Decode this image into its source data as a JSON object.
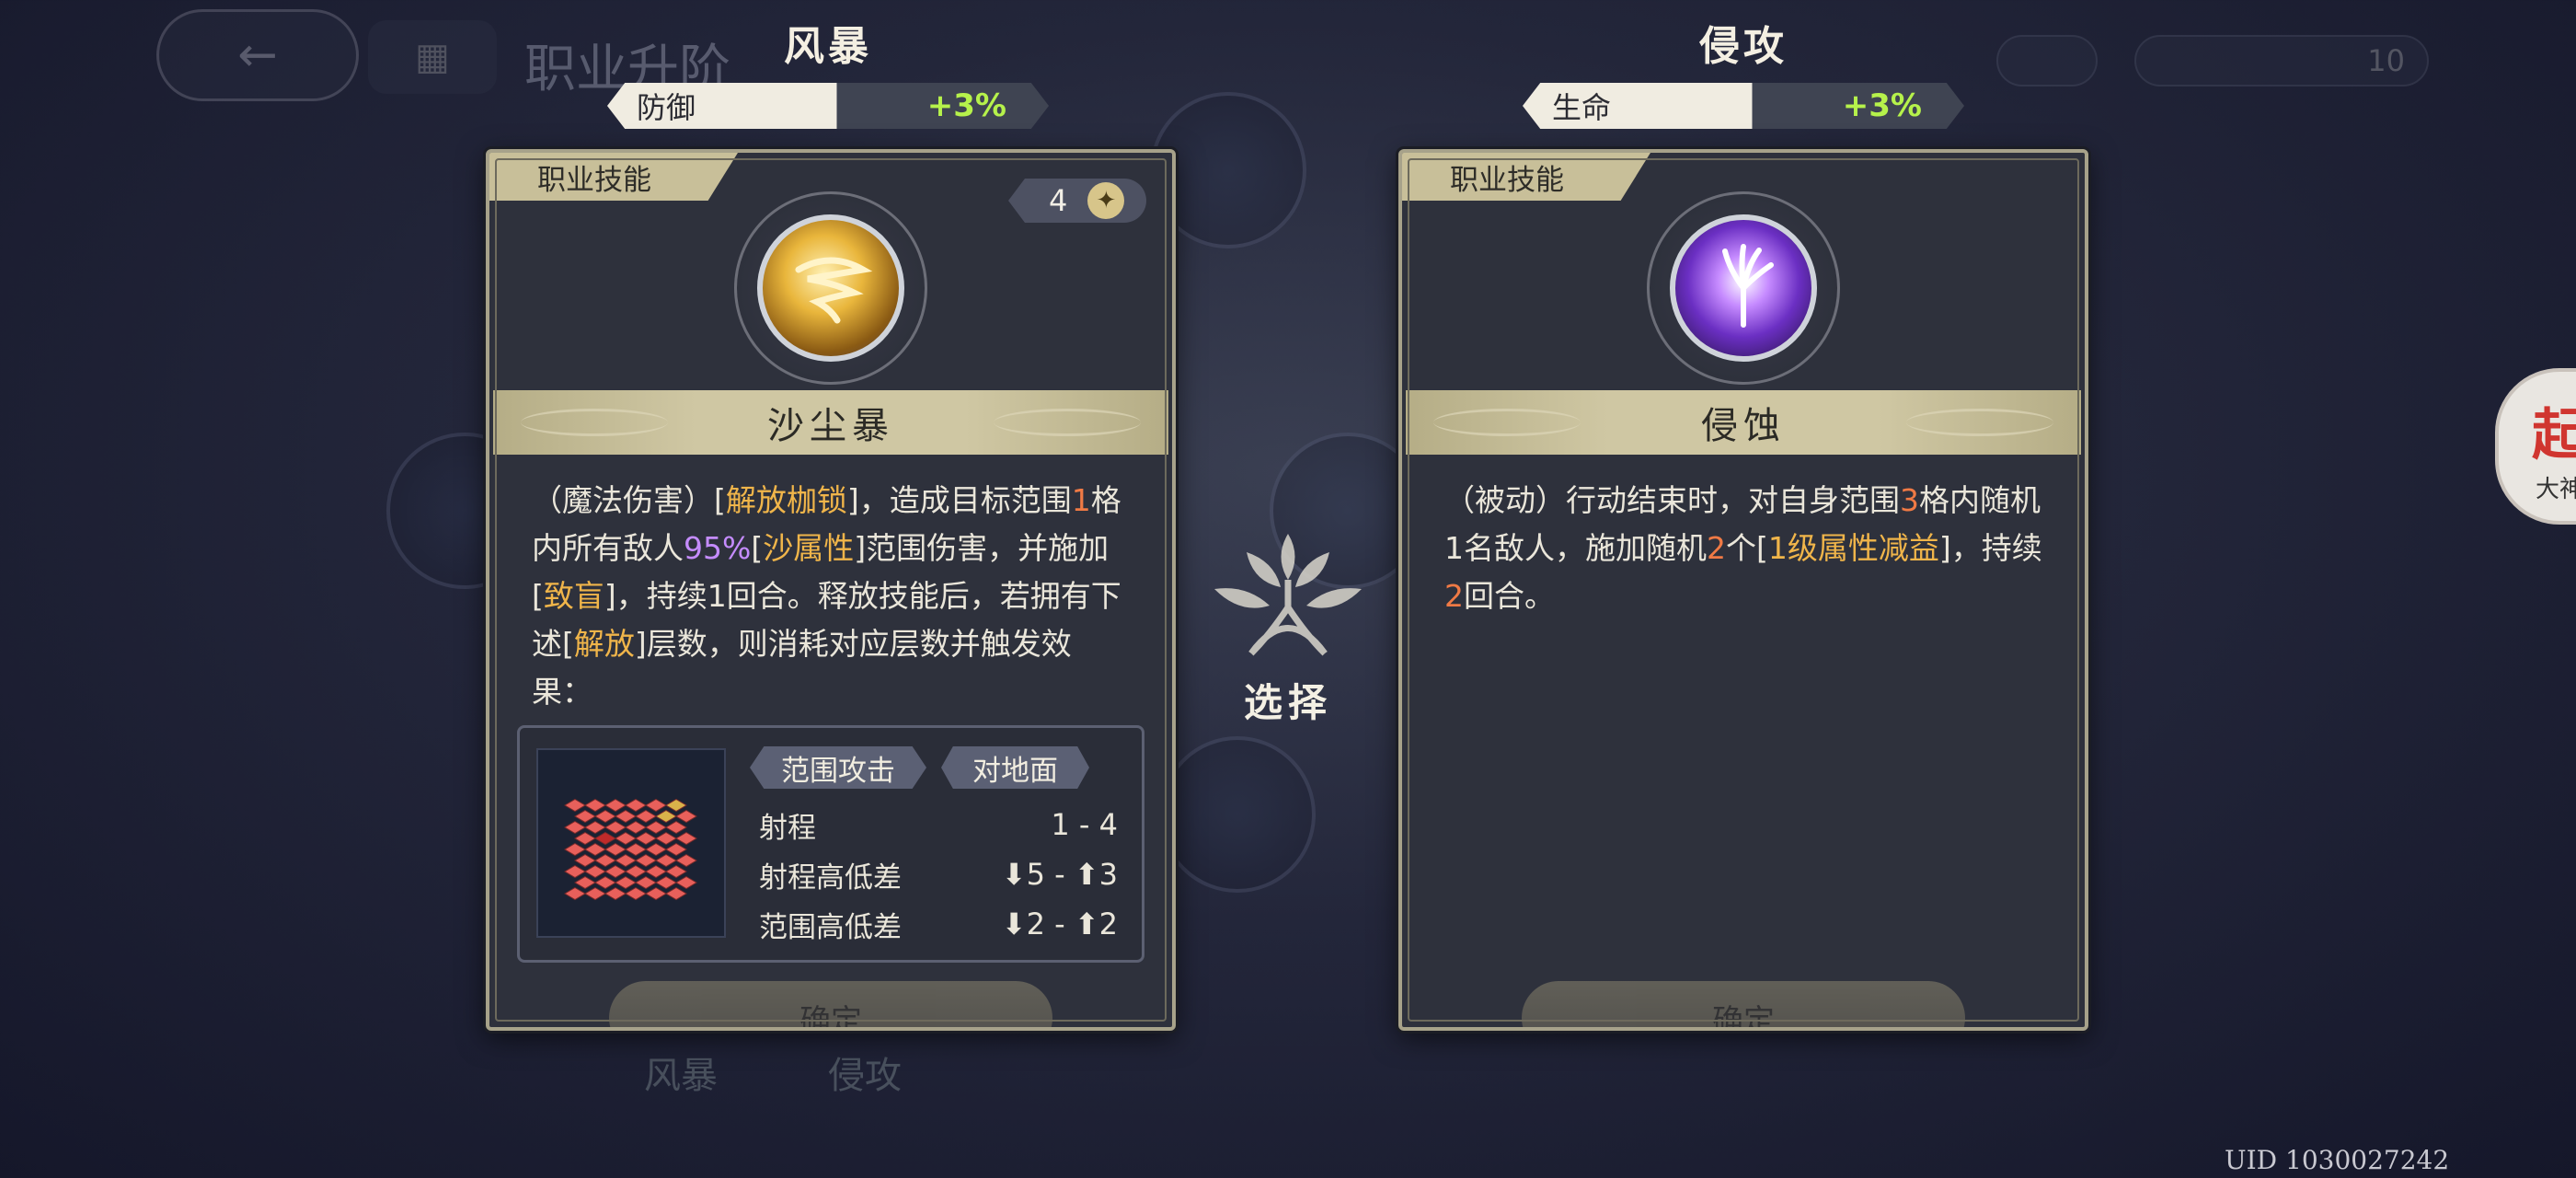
{
  "background": {
    "title": "职业升阶",
    "bottom_left": "风暴",
    "bottom_right": "侵攻",
    "pill_right_value": "10",
    "side_badge_char": "起",
    "side_badge_sub": "大神"
  },
  "options": [
    {
      "name": "风暴",
      "stat_label": "防御",
      "stat_value": "+3%",
      "tag": "职业技能",
      "count": "4",
      "skill_name": "沙尘暴",
      "skill_icon": "sandstorm-icon",
      "desc": [
        {
          "t": "（魔法伤害）["
        },
        {
          "t": "解放枷锁",
          "c": "y"
        },
        {
          "t": "]，造成目标范围"
        },
        {
          "t": "1",
          "c": "o"
        },
        {
          "t": "格内所有敌人"
        },
        {
          "t": "95%",
          "c": "p"
        },
        {
          "t": "["
        },
        {
          "t": "沙属性",
          "c": "y"
        },
        {
          "t": "]范围伤害，并施加["
        },
        {
          "t": "致盲",
          "c": "y"
        },
        {
          "t": "]，持续1回合。释放技能后，若拥有下述["
        },
        {
          "t": "解放",
          "c": "y"
        },
        {
          "t": "]层数，则消耗对应层数并触发效果："
        }
      ],
      "range": {
        "tag1": "范围攻击",
        "tag2": "对地面",
        "rows": [
          {
            "label": "射程",
            "value": "1 - 4"
          },
          {
            "label": "射程高低差",
            "value": "⬇5 - ⬆3"
          },
          {
            "label": "范围高低差",
            "value": "⬇2 - ⬆2"
          }
        ]
      },
      "confirm": "确定"
    },
    {
      "name": "侵攻",
      "stat_label": "生命",
      "stat_value": "+3%",
      "tag": "职业技能",
      "skill_name": "侵蚀",
      "skill_icon": "erosion-icon",
      "desc": [
        {
          "t": "（被动）行动结束时，对自身范围"
        },
        {
          "t": "3",
          "c": "o"
        },
        {
          "t": "格内随机1名敌人，施加随机"
        },
        {
          "t": "2",
          "c": "o"
        },
        {
          "t": "个["
        },
        {
          "t": "1级属性减益",
          "c": "y"
        },
        {
          "t": "]，持续"
        },
        {
          "t": "2",
          "c": "o"
        },
        {
          "t": "回合。"
        }
      ],
      "confirm": "确定"
    }
  ],
  "select_label": "选择",
  "uid": "UID 1030027242",
  "colors": {
    "accent_gold": "#c8bf99",
    "highlight_yellow": "#f0b54a",
    "highlight_purple": "#c58cff",
    "highlight_orange": "#f07a45",
    "stat_green": "#b6f24b"
  }
}
